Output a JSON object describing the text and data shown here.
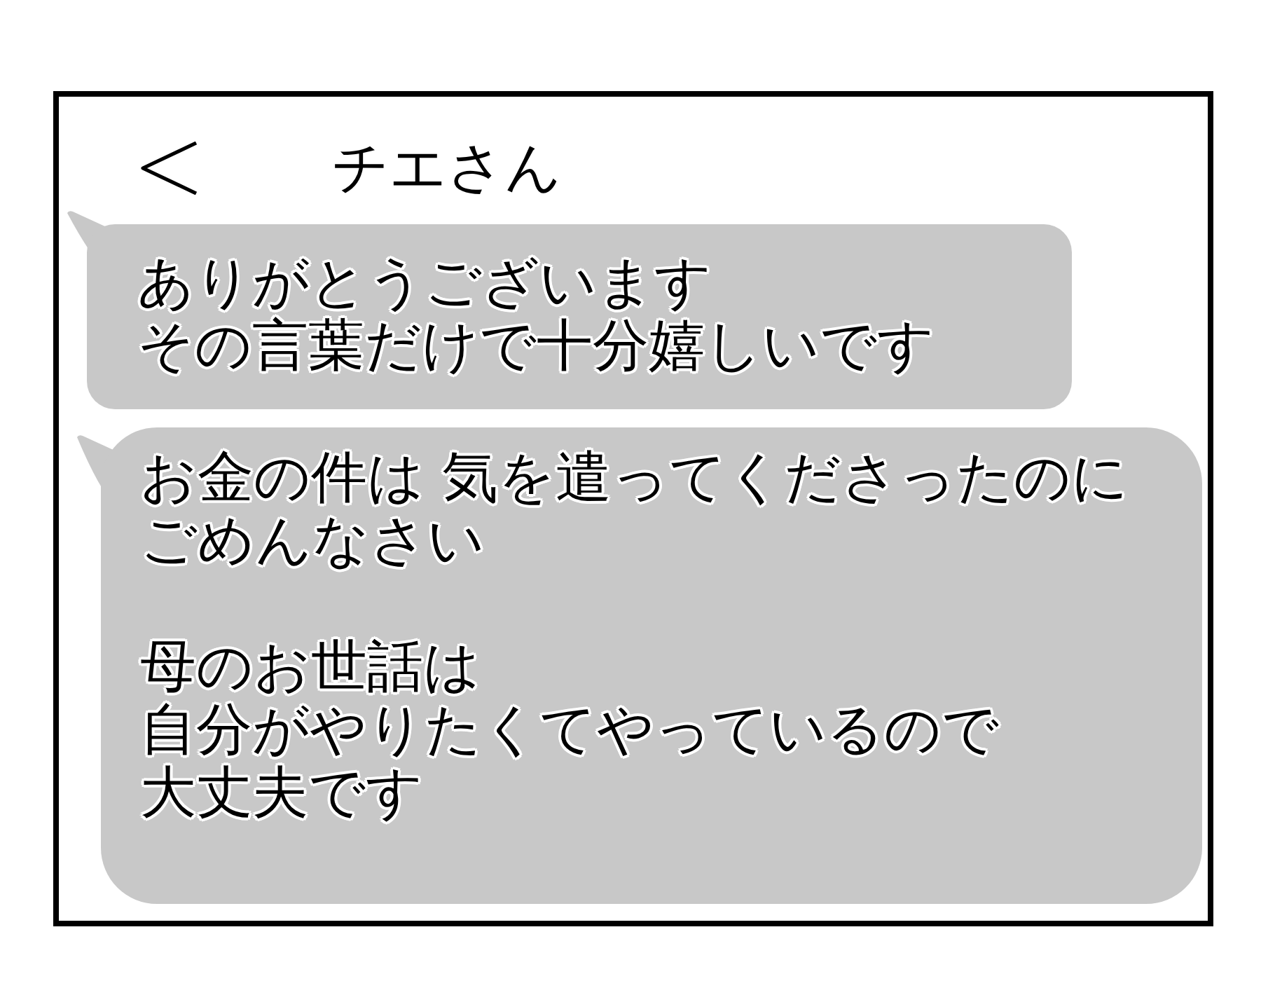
{
  "header": {
    "title": "チエさん"
  },
  "messages": [
    {
      "paragraphs": [
        [
          "ありがとうございます",
          "その言葉だけで十分嬉しいです"
        ]
      ]
    },
    {
      "paragraphs": [
        [
          "お金の件は 気を遣ってくださったのに",
          "ごめんなさい"
        ],
        [
          "母のお世話は",
          "自分がやりたくてやっているので",
          "大丈夫です"
        ]
      ]
    }
  ]
}
